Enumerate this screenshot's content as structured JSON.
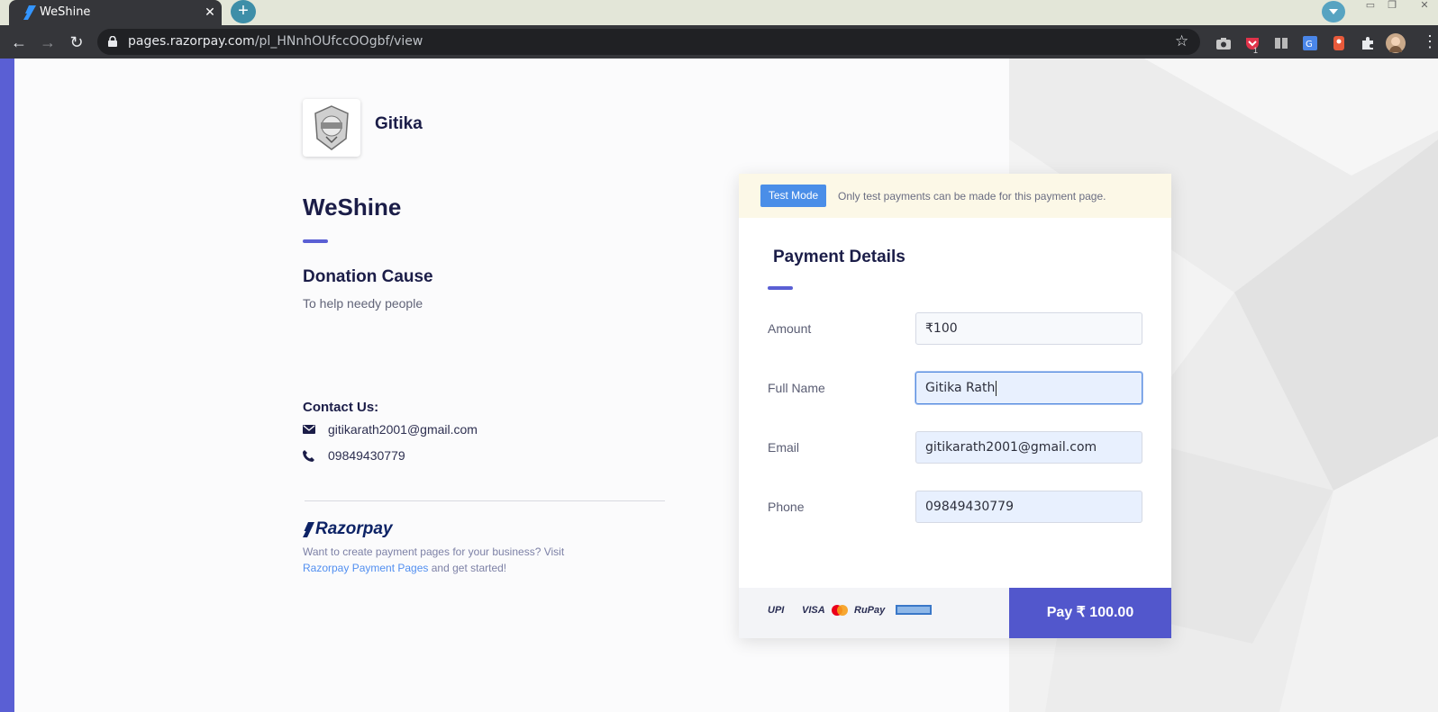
{
  "browser": {
    "tab_title": "WeShine",
    "tab_close": "✕",
    "new_tab": "+",
    "url_host": "pages.razorpay.com",
    "url_path": "/pl_HNnhOUfccOOgbf/view",
    "ext_badge": "1"
  },
  "merchant": {
    "name": "Gitika"
  },
  "page": {
    "title": "WeShine",
    "cause_title": "Donation Cause",
    "cause_text": "To help needy people",
    "contact_title": "Contact Us:",
    "contact_email": "gitikarath2001@gmail.com",
    "contact_phone": "09849430779"
  },
  "footer_promo": {
    "brand": "Razorpay",
    "text_before": "Want to create payment pages for your business? Visit",
    "link": "Razorpay Payment Pages",
    "text_after": "and get started!"
  },
  "payment": {
    "test_badge": "Test Mode",
    "test_message": "Only test payments can be made for this payment page.",
    "title": "Payment Details",
    "fields": {
      "amount_label": "Amount",
      "amount_currency": "₹",
      "amount_value": "100",
      "name_label": "Full Name",
      "name_value": "Gitika Rath",
      "email_label": "Email",
      "email_value": "gitikarath2001@gmail.com",
      "phone_label": "Phone",
      "phone_value": "09849430779"
    },
    "brands": [
      "UPI",
      "VISA",
      "RuPay"
    ],
    "pay_button": "Pay  ₹ 100.00"
  },
  "colors": {
    "accent": "#5a5fd4",
    "pay_button": "#5257cc",
    "test_badge": "#4a8ee8",
    "test_bar": "#fcf8e7"
  }
}
